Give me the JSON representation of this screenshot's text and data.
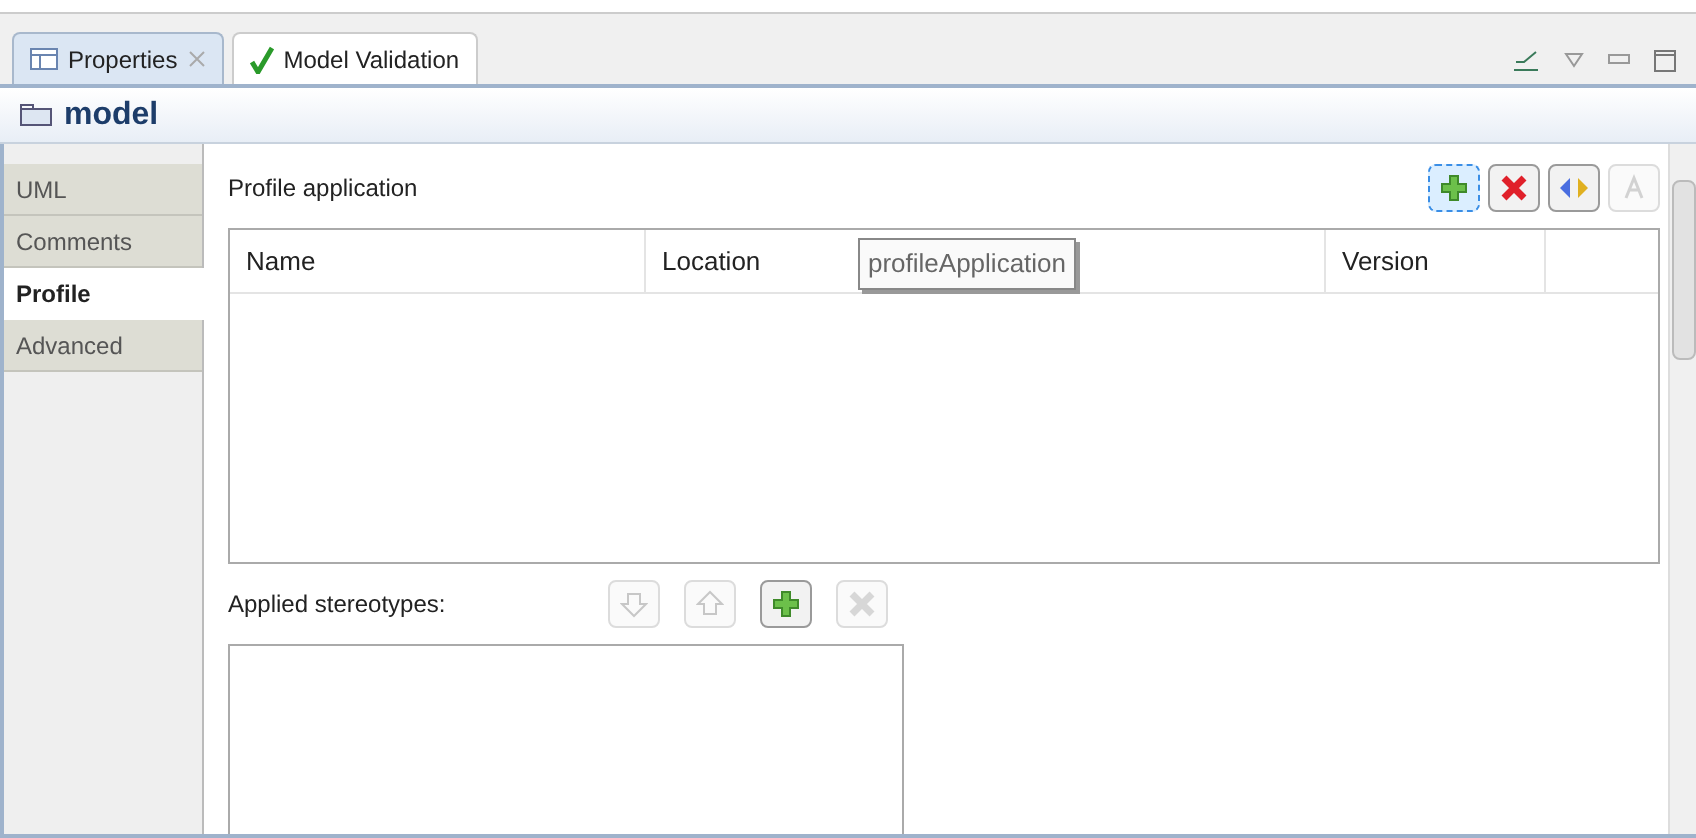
{
  "tabs": [
    {
      "label": "Properties",
      "kind": "properties",
      "selected": true
    },
    {
      "label": "Model Validation",
      "kind": "validation",
      "selected": false
    }
  ],
  "header": {
    "title": "model"
  },
  "sidebar": {
    "items": [
      {
        "label": "UML",
        "selected": false
      },
      {
        "label": "Comments",
        "selected": false
      },
      {
        "label": "Profile",
        "selected": true
      },
      {
        "label": "Advanced",
        "selected": false
      }
    ]
  },
  "profile_application": {
    "label": "Profile application",
    "buttons": [
      {
        "kind": "add",
        "disabled": false,
        "focused": true
      },
      {
        "kind": "remove",
        "disabled": false,
        "focused": false
      },
      {
        "kind": "apply",
        "disabled": false,
        "focused": false
      },
      {
        "kind": "browse",
        "disabled": true,
        "focused": false
      }
    ],
    "columns": [
      "Name",
      "Location",
      "Version"
    ],
    "tooltip": "profileApplication"
  },
  "applied_stereotypes": {
    "label": "Applied stereotypes:",
    "buttons": [
      {
        "kind": "down",
        "disabled": true
      },
      {
        "kind": "up",
        "disabled": true
      },
      {
        "kind": "add",
        "disabled": false
      },
      {
        "kind": "remove",
        "disabled": true
      }
    ]
  }
}
